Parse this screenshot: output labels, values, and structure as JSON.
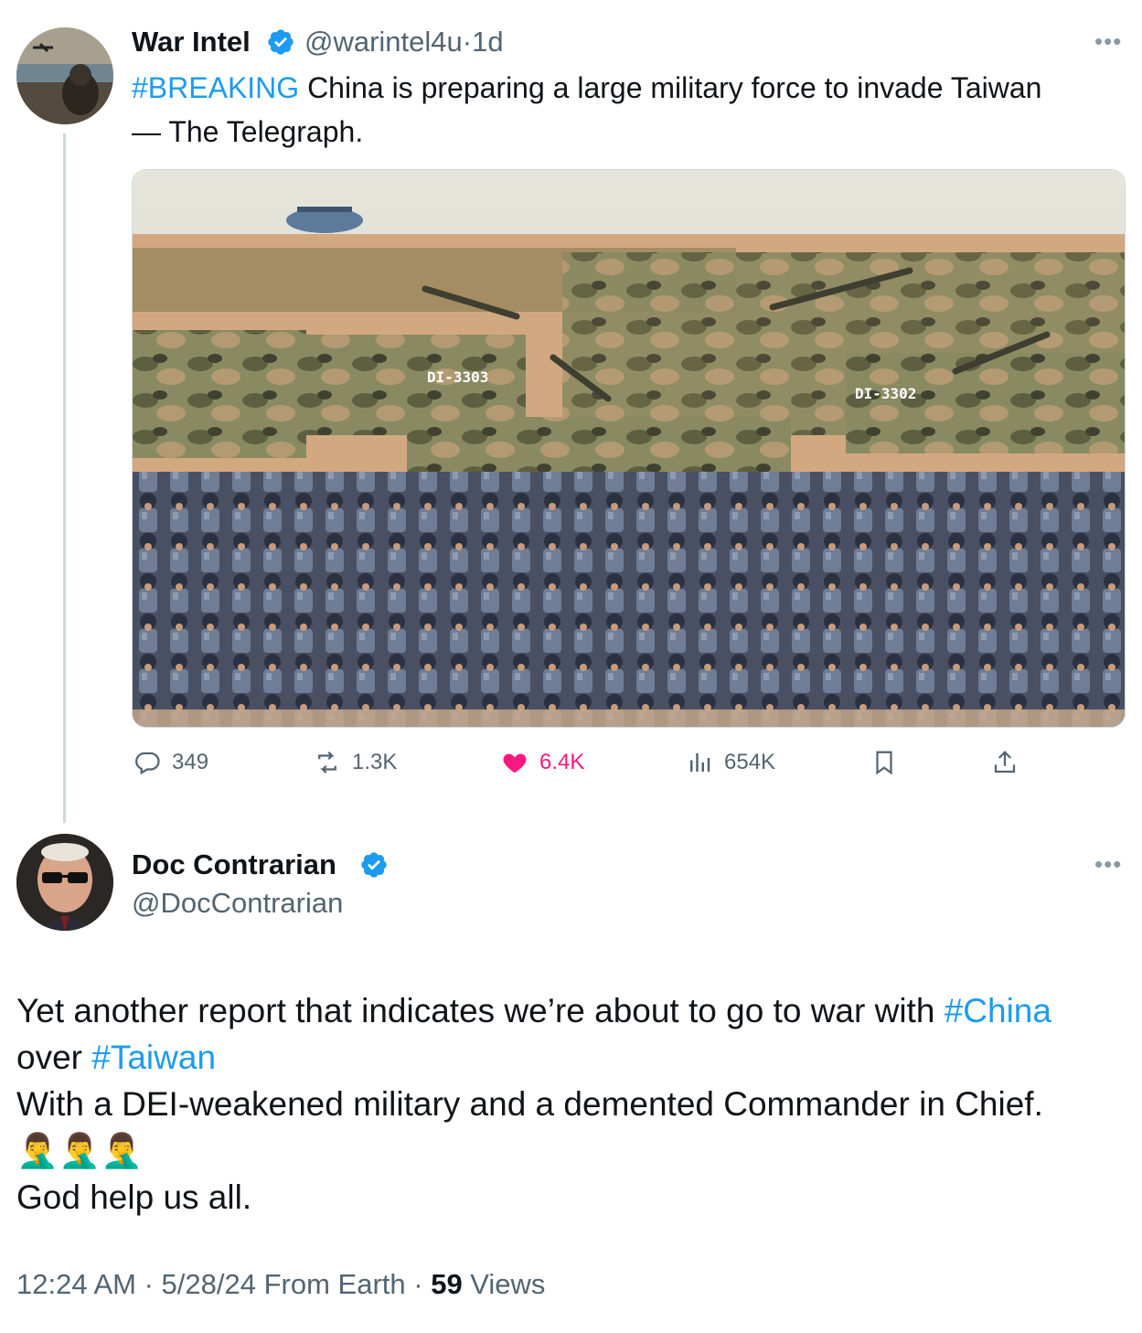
{
  "original_tweet": {
    "author_name": "War Intel",
    "author_handle": "@warintel4u",
    "time_sep": "·",
    "time_ago": "1d",
    "text_hashtag": "#BREAKING",
    "text_line1_rest": " China is preparing a large military force to invade Taiwan",
    "text_line2": "— The Telegraph.",
    "media_icon": "military-parade-photo",
    "stats": {
      "replies": "349",
      "reposts": "1.3K",
      "likes": "6.4K",
      "views": "654K"
    }
  },
  "reply_tweet": {
    "author_name": "Doc Contrarian",
    "author_handle": "@DocContrarian",
    "line1_text": "Yet another report that indicates we’re about to go to war with ",
    "line1_hashtag": "#China",
    "line2_text": "over ",
    "line2_hashtag": "#Taiwan",
    "line3": "With a DEI-weakened military and a demented Commander in Chief.",
    "line4_emoji": "🤦‍♂️🤦‍♂️🤦‍♂️",
    "line5": "God help us all."
  },
  "meta": {
    "time": "12:24 AM",
    "sep1": " · ",
    "date": "5/28/24",
    "source": " From Earth",
    "sep2": " · ",
    "views_count": "59",
    "views_label": " Views"
  },
  "colors": {
    "accent": "#1d9bf0",
    "like": "#f91880",
    "muted": "#536471"
  }
}
